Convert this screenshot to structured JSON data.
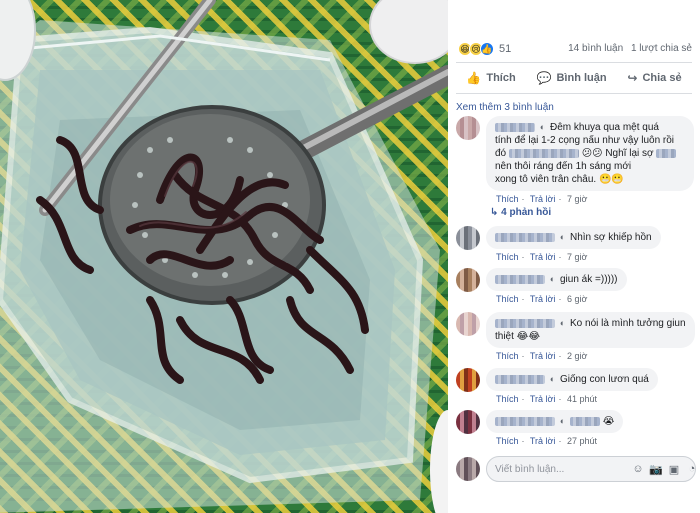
{
  "post": {
    "reaction_count": "51",
    "reaction_icons": [
      "haha",
      "sad",
      "like"
    ],
    "comment_count": "14 bình luận",
    "share_count": "1 lượt chia sẻ"
  },
  "actions": {
    "like": "Thích",
    "comment": "Bình luận",
    "share": "Chia sẻ"
  },
  "more_comments": "Xem thêm 3 bình luận",
  "comments": [
    {
      "line1": "Đêm khuya qua mệt quá",
      "line2": "tính để lại 1-2 cọng nấu như vậy luôn rồi đó",
      "line3": "nên thôi ráng đến 1h sáng mới",
      "line3_prefix": "Nghĩ lại sợ",
      "line4": "xong tô viên trân châu. 😬😬",
      "emoji": "😕😕",
      "like": "Thích",
      "reply": "Trả lời",
      "time": "7 giờ"
    },
    {
      "text": "Nhìn sợ khiếp hồn",
      "like": "Thích",
      "reply": "Trả lời",
      "time": "7 giờ"
    },
    {
      "text": "giun ák =)))))",
      "like": "Thích",
      "reply": "Trả lời",
      "time": "6 giờ"
    },
    {
      "text": "Ko nói là mình tưởng giun",
      "text2": "thiệt 😂😂",
      "like": "Thích",
      "reply": "Trả lời",
      "time": "2 giờ"
    },
    {
      "text": "Giống con lươn quá",
      "like": "Thích",
      "reply": "Trả lời",
      "time": "41 phút"
    },
    {
      "text": "😭",
      "like": "Thích",
      "reply": "Trả lời",
      "time": "27 phút"
    }
  ],
  "replies_link": "4 phản hồi",
  "write_placeholder": "Viết bình luận...",
  "colors": {
    "link": "#385898",
    "meta": "#606770",
    "bubble": "#f2f3f5"
  }
}
